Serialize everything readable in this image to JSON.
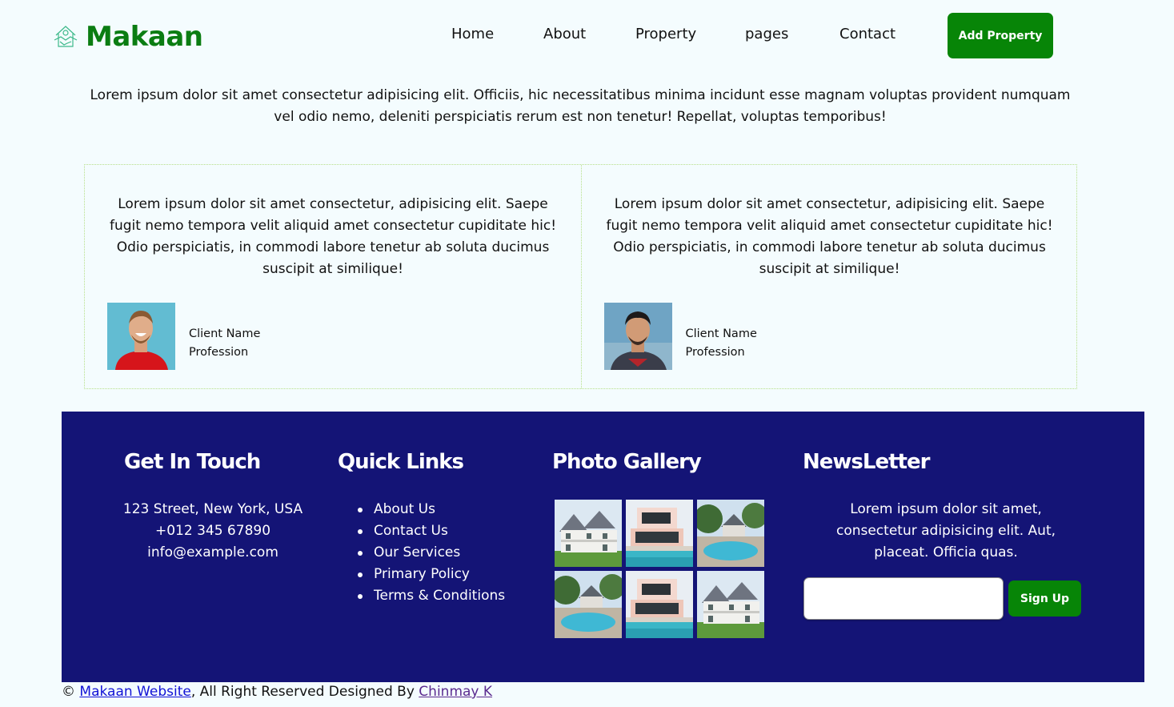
{
  "brand": {
    "name": "Makaan",
    "logo_icon": "house-handshake-icon",
    "color": "#0b7d12"
  },
  "nav": {
    "items": [
      "Home",
      "About",
      "Property",
      "pages",
      "Contact"
    ],
    "add_property_label": "Add Property"
  },
  "intro": {
    "text": "Lorem ipsum dolor sit amet consectetur adipisicing elit. Officiis, hic necessitatibus minima incidunt esse magnam voluptas provident numquam vel odio nemo, deleniti perspiciatis rerum est non tenetur! Repellat, voluptas temporibus!"
  },
  "testimonials": [
    {
      "quote": "Lorem ipsum dolor sit amet consectetur, adipisicing elit. Saepe fugit nemo tempora velit aliquid amet consectetur cupiditate hic! Odio perspiciatis, in commodi labore tenetur ab soluta ducimus suscipit at similique!",
      "name": "Client Name",
      "profession": "Profession"
    },
    {
      "quote": "Lorem ipsum dolor sit amet consectetur, adipisicing elit. Saepe fugit nemo tempora velit aliquid amet consectetur cupiditate hic! Odio perspiciatis, in commodi labore tenetur ab soluta ducimus suscipit at similique!",
      "name": "Client Name",
      "profession": "Profession"
    }
  ],
  "footer": {
    "bg_color": "#141476",
    "get_in_touch": {
      "heading": "Get In Touch",
      "address": "123 Street, New York, USA",
      "phone": "+012 345 67890",
      "email": "info@example.com"
    },
    "quick_links": {
      "heading": "Quick Links",
      "items": [
        "About Us",
        "Contact Us",
        "Our Services",
        "Primary Policy",
        "Terms & Conditions"
      ]
    },
    "photo_gallery": {
      "heading": "Photo Gallery"
    },
    "newsletter": {
      "heading": "NewsLetter",
      "text": "Lorem ipsum dolor sit amet, consectetur adipisicing elit. Aut, placeat. Officia quas.",
      "input_placeholder": "",
      "button_label": "Sign Up"
    }
  },
  "copyright": {
    "symbol": "©",
    "site_link": "Makaan Website",
    "middle": ", All Right Reserved Designed By ",
    "author_link": "Chinmay K"
  }
}
